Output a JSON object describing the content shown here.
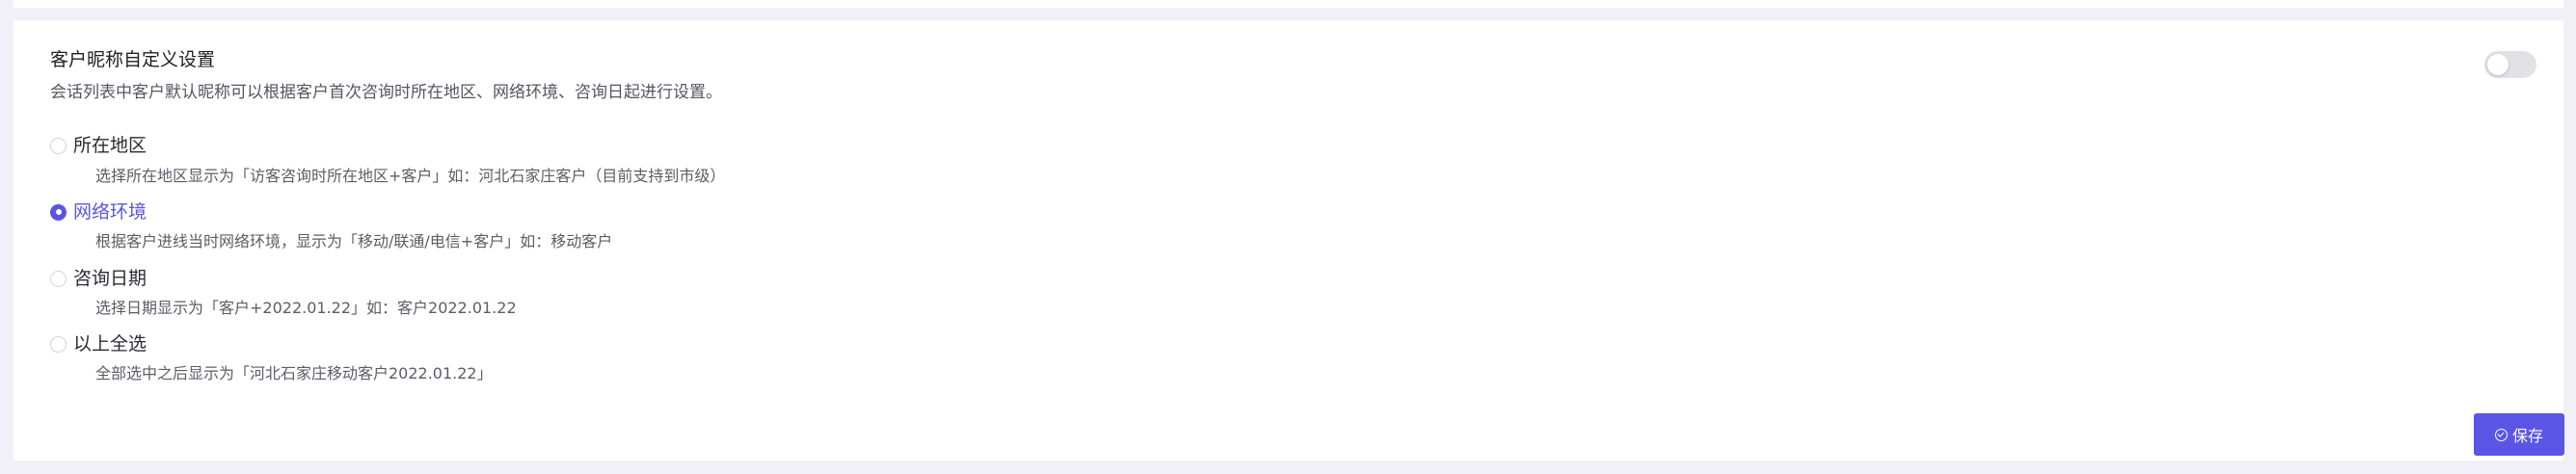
{
  "settings": {
    "title": "客户昵称自定义设置",
    "description": "会话列表中客户默认昵称可以根据客户首次咨询时所在地区、网络环境、咨询日起进行设置。",
    "enabled": false,
    "selected_option": "网络环境",
    "options": [
      {
        "label": "所在地区",
        "description": "选择所在地区显示为「访客咨询时所在地区+客户」如：河北石家庄客户（目前支持到市级）",
        "checked": false
      },
      {
        "label": "网络环境",
        "description": "根据客户进线当时网络环境，显示为「移动/联通/电信+客户」如：移动客户",
        "checked": true
      },
      {
        "label": "咨询日期",
        "description": "选择日期显示为「客户+2022.01.22」如：客户2022.01.22",
        "checked": false
      },
      {
        "label": "以上全选",
        "description": "全部选中之后显示为「河北石家庄移动客户2022.01.22」",
        "checked": false
      }
    ]
  },
  "actions": {
    "save_label": "保存",
    "save_icon": "check-circle-icon"
  },
  "colors": {
    "accent": "#5b55e6",
    "page_bg": "#f0f0f6",
    "card_bg": "#ffffff"
  }
}
